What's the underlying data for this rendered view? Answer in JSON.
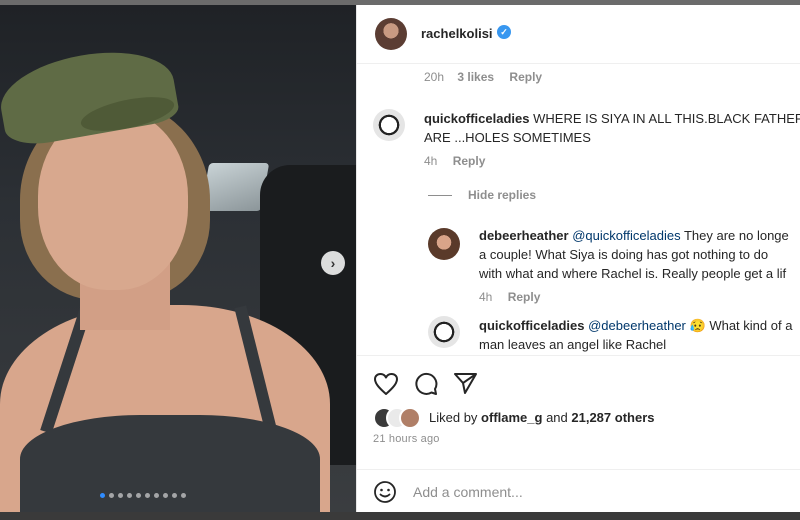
{
  "post": {
    "author": "rachelkolisi",
    "verified_mark": "✓",
    "carousel": {
      "next_glyph": "›",
      "slide_count": 10,
      "active_index": 0
    }
  },
  "comments": [
    {
      "time": "20h",
      "likes": "3 likes",
      "reply": "Reply"
    },
    {
      "username": "quickofficeladies",
      "text_line1": "WHERE IS SIYA IN ALL THIS.BLACK FATHERS",
      "text_line2": "ARE ...HOLES SOMETIMES",
      "time": "4h",
      "reply": "Reply",
      "hide_replies": "Hide replies",
      "replies": [
        {
          "username": "debeerheather",
          "mention": "@quickofficeladies",
          "text_line1": "They are no longe",
          "text_line2": "a couple! What Siya is doing has got nothing to do",
          "text_line3": "with what and where Rachel is. Really people get a lif",
          "time": "4h",
          "reply": "Reply"
        },
        {
          "username": "quickofficeladies",
          "mention": "@debeerheather",
          "emoji": "😥",
          "text_line1": "What kind of a",
          "text_line2": "man leaves an angel like Rachel"
        }
      ]
    }
  ],
  "likes": {
    "prefix": "Liked by ",
    "first_user": "offlame_g",
    "middle": " and ",
    "others": "21,287 others"
  },
  "timestamp": "21 hours ago",
  "add_comment": {
    "placeholder": "Add a comment..."
  },
  "icons": [
    "heart-icon",
    "comment-icon",
    "share-icon",
    "emoji-icon",
    "verified-icon",
    "chevron-right-icon"
  ],
  "colors": {
    "link": "#00376b",
    "verified": "#3897f0",
    "muted": "#8e8e8e",
    "carousel_active": "#2f8cff"
  }
}
